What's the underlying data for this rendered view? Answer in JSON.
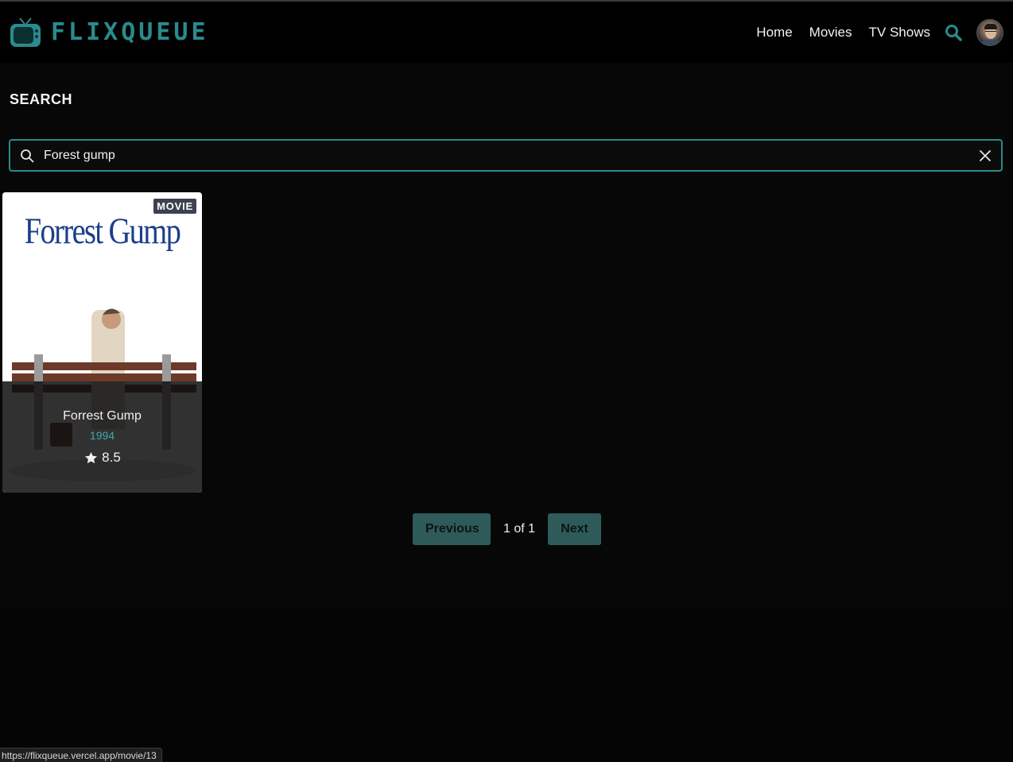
{
  "header": {
    "brand": "FLIXQUEUE",
    "nav": [
      {
        "label": "Home"
      },
      {
        "label": "Movies"
      },
      {
        "label": "TV Shows"
      }
    ]
  },
  "search": {
    "title": "SEARCH",
    "value": "Forest gump"
  },
  "results": [
    {
      "poster_title": "Forrest Gump",
      "badge": "MOVIE",
      "title": "Forrest Gump",
      "year": "1994",
      "rating": "8.5"
    }
  ],
  "pagination": {
    "previous_label": "Previous",
    "page_info": "1 of 1",
    "next_label": "Next"
  },
  "status_bar": {
    "url": "https://flixqueue.vercel.app/movie/13"
  },
  "colors": {
    "accent": "#2b8a8d",
    "button_bg": "#2e5b59",
    "year_text": "#3fa8a8",
    "background": "#070707"
  },
  "icons": [
    "tv-logo-icon",
    "search-icon",
    "close-icon",
    "star-icon"
  ]
}
